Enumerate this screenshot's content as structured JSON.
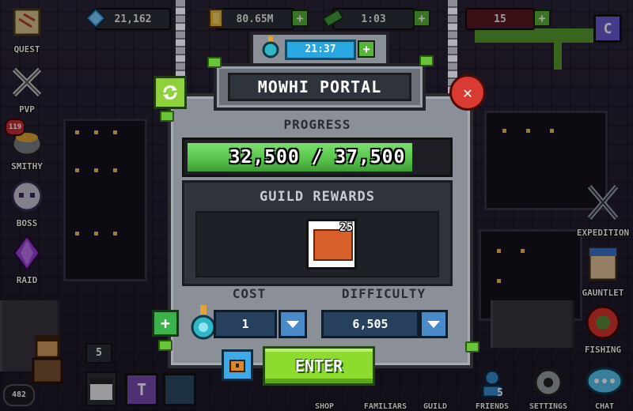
{
  "hud": {
    "gems": "21,162",
    "gold": "80.65M",
    "tickets": "1:03",
    "energy": "15"
  },
  "left_menu": [
    {
      "label": "QUEST",
      "icon": "quest-map-icon"
    },
    {
      "label": "PVP",
      "icon": "crossed-swords-icon"
    },
    {
      "label": "SMITHY",
      "icon": "smithy-pot-icon",
      "badge": "119"
    },
    {
      "label": "BOSS",
      "icon": "boss-skull-icon"
    },
    {
      "label": "RAID",
      "icon": "raid-crystal-icon"
    }
  ],
  "right_menu": [
    {
      "label": "EXPEDITION",
      "icon": "expedition-swords-icon"
    },
    {
      "label": "GAUNTLET",
      "icon": "gauntlet-face-icon"
    },
    {
      "label": "FISHING",
      "icon": "fishing-lifebuoy-icon"
    }
  ],
  "bottom_bar": [
    {
      "label": "SHOP"
    },
    {
      "label": "FAMILIARS"
    },
    {
      "label": "GUILD"
    },
    {
      "label": "FRIENDS",
      "badge": "5"
    },
    {
      "label": "SETTINGS"
    },
    {
      "label": "CHAT"
    }
  ],
  "player": {
    "level_badge": "482",
    "counter": "5"
  },
  "modal": {
    "timer": "21:37",
    "title": "MOWHI PORTAL",
    "progress_label": "PROGRESS",
    "progress_current": 32500,
    "progress_max": 37500,
    "progress_text": "32,500 / 37,500",
    "rewards_title": "GUILD REWARDS",
    "reward_qty": "25",
    "reward_icon": "orange-chest-icon",
    "cost_label": "COST",
    "cost_value": "1",
    "difficulty_label": "DIFFICULTY",
    "difficulty_value": "6,505",
    "enter_label": "ENTER"
  },
  "colors": {
    "accent_green": "#8edb2f",
    "close_red": "#d93a32",
    "timer_blue": "#29a7e0",
    "progress_green": "#56c24b"
  }
}
